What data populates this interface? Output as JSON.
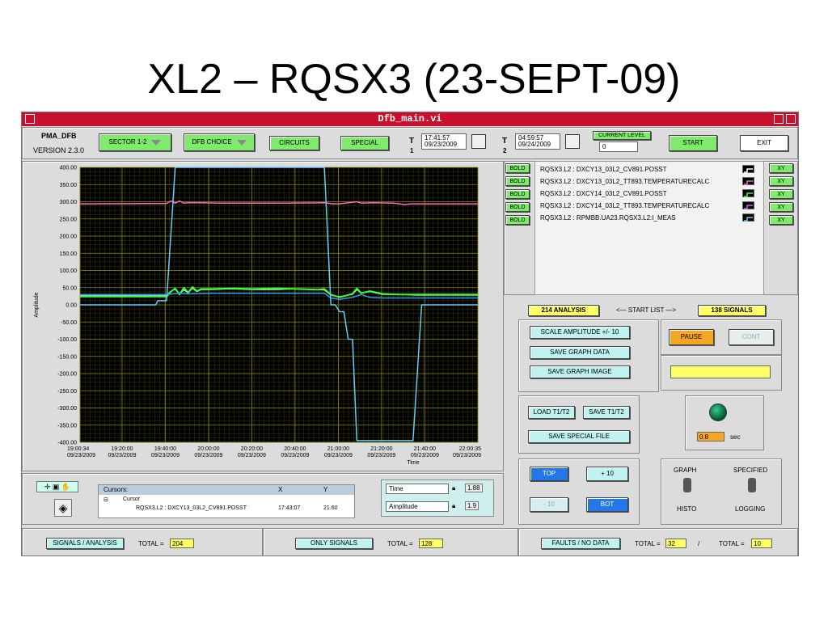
{
  "slide": {
    "title": "XL2 – RQSX3 (23-SEPT-09)"
  },
  "window": {
    "title": "Dfb_main.vi"
  },
  "header": {
    "app_name": "PMA_DFB",
    "version": "VERSION 2.3.0",
    "sector_label": "SECTOR 1-2",
    "dfb_choice_label": "DFB CHOICE",
    "circuits_label": "CIRCUITS",
    "special_label": "SPECIAL",
    "t1_label": "T",
    "t1_index": "1",
    "t1_time": "17:41:57",
    "t1_date": "09/23/2009",
    "t2_label": "T",
    "t2_index": "2",
    "t2_time": "04:59:57",
    "t2_date": "09/24/2009",
    "current_level_label": "CURRENT LEVEL",
    "current_level_value": "0",
    "start_label": "START",
    "exit_label": "EXIT"
  },
  "signals": {
    "bold_label": "BOLD",
    "xy_label": "XY",
    "items": [
      {
        "name": "RQSX3.L2 : DXCY13_03L2_CV891.POSST",
        "color": "#ffffff"
      },
      {
        "name": "RQSX3.L2 : DXCY13_03L2_TT893.TEMPERATURECALC",
        "color": "#ff66cc"
      },
      {
        "name": "RQSX3.L2 : DXCY14_03L2_CV891.POSST",
        "color": "#33ff33"
      },
      {
        "name": "RQSX3.L2 : DXCY14_03L2_TT893.TEMPERATURECALC",
        "color": "#cc66ff"
      },
      {
        "name": "RQSX3.L2 : RPMBB.UA23.RQSX3.L2:I_MEAS",
        "color": "#66ccff"
      }
    ]
  },
  "lists": {
    "analysis": "214 ANALYSIS",
    "start_list": "<— START LIST —>",
    "signals": "138 SIGNALS"
  },
  "controls": {
    "scale_amplitude": "SCALE AMPLITUDE +/- 10",
    "save_graph_data": "SAVE GRAPH DATA",
    "save_graph_image": "SAVE GRAPH IMAGE",
    "pause": "PAUSE",
    "cont": "CONT",
    "load_t1t2": "LOAD T1/T2",
    "save_t1t2": "SAVE T1/T2",
    "save_special_file": "SAVE SPECIAL FILE",
    "delay_value": "0.8",
    "delay_unit": "sec",
    "top": "TOP",
    "plus10": "+ 10",
    "minus10": "- 10",
    "bot": "BOT",
    "graph": "GRAPH",
    "histo": "HISTO",
    "specified": "SPECIFIED",
    "logging": "LOGGING"
  },
  "cursors": {
    "title": "Cursors:",
    "col_x": "X",
    "col_y": "Y",
    "cursor_label": "Cursor",
    "signal": "RQSX3.L2 : DXCY13_03L2_CV891.POSST",
    "x_value": "17:43:07",
    "y_value": "21.60"
  },
  "scales": {
    "time": "Time",
    "amplitude": "Amplitude",
    "fmt_x": "1.88",
    "fmt_y": "1.9"
  },
  "footer": {
    "signals_analysis": "SIGNALS / ANALYSIS",
    "total_label": "TOTAL =",
    "total_1": "204",
    "only_signals": "ONLY SIGNALS",
    "total_2": "128",
    "faults": "FAULTS / NO DATA",
    "total_3": "32",
    "sep": "/",
    "total_4": "10"
  },
  "chart_data": {
    "type": "line",
    "xlabel": "Time",
    "ylabel": "Amplitude",
    "ylim": [
      -400,
      400
    ],
    "yticks": [
      400,
      350,
      300,
      250,
      200,
      150,
      100,
      50,
      0,
      -50,
      -100,
      -150,
      -200,
      -250,
      -300,
      -350,
      -400
    ],
    "ytick_labels": [
      "400.00",
      "350.00",
      "300.00",
      "250.00",
      "200.00",
      "150.00",
      "100.00",
      "50.00",
      "0.00",
      "-50.00",
      "-100.00",
      "-150.00",
      "-200.00",
      "-250.00",
      "-300.00",
      "-350.00",
      "-400.00"
    ],
    "xlim": [
      0,
      123.97
    ],
    "xticks": [
      0,
      19.43,
      39.43,
      59.43,
      79.43,
      99.43,
      119.43,
      139.43,
      159.43,
      183.97
    ],
    "xtick_labels": [
      [
        "19:00:34",
        "09/23/2009"
      ],
      [
        "19:20:00",
        "09/23/2009"
      ],
      [
        "19:40:00",
        "09/23/2009"
      ],
      [
        "20:00:00",
        "09/23/2009"
      ],
      [
        "20:20:00",
        "09/23/2009"
      ],
      [
        "20:40:00",
        "09/23/2009"
      ],
      [
        "21:00:00",
        "09/23/2009"
      ],
      [
        "21:20:00",
        "09/23/2009"
      ],
      [
        "21:40:00",
        "09/23/2009"
      ],
      [
        "22:00:35",
        "09/23/2009"
      ]
    ],
    "x_domain": [
      0,
      183.97
    ],
    "grid": true,
    "series": [
      {
        "color": "#ff66cc",
        "width": 1.5,
        "points": [
          [
            0,
            294
          ],
          [
            40,
            295
          ],
          [
            42,
            302
          ],
          [
            44,
            296
          ],
          [
            46,
            302
          ],
          [
            48,
            296
          ],
          [
            50,
            297
          ],
          [
            55,
            297
          ],
          [
            65,
            296
          ],
          [
            80,
            296
          ],
          [
            95,
            296
          ],
          [
            113,
            297
          ],
          [
            117,
            294
          ],
          [
            120,
            294
          ],
          [
            128,
            300
          ],
          [
            130,
            296
          ],
          [
            135,
            297
          ],
          [
            145,
            296
          ],
          [
            150,
            292
          ],
          [
            153,
            294
          ],
          [
            158,
            294
          ],
          [
            170,
            294
          ],
          [
            183.97,
            294
          ]
        ]
      },
      {
        "color": "#ffffff",
        "width": 1,
        "points": [
          [
            0,
            28
          ],
          [
            40,
            28
          ],
          [
            42,
            40
          ],
          [
            44,
            45
          ],
          [
            46,
            30
          ],
          [
            48,
            44
          ],
          [
            50,
            34
          ],
          [
            52,
            48
          ],
          [
            54,
            38
          ],
          [
            56,
            44
          ],
          [
            60,
            44
          ],
          [
            70,
            46
          ],
          [
            80,
            44
          ],
          [
            90,
            44
          ],
          [
            100,
            46
          ],
          [
            110,
            44
          ],
          [
            113,
            43
          ],
          [
            116,
            28
          ],
          [
            120,
            24
          ],
          [
            126,
            30
          ],
          [
            128,
            44
          ],
          [
            130,
            34
          ],
          [
            134,
            38
          ],
          [
            140,
            30
          ],
          [
            148,
            30
          ],
          [
            155,
            28
          ],
          [
            170,
            28
          ],
          [
            183.97,
            28
          ]
        ]
      },
      {
        "color": "#33ff33",
        "width": 2,
        "points": [
          [
            0,
            24
          ],
          [
            40,
            24
          ],
          [
            42,
            38
          ],
          [
            44,
            48
          ],
          [
            46,
            30
          ],
          [
            48,
            50
          ],
          [
            50,
            36
          ],
          [
            52,
            52
          ],
          [
            54,
            40
          ],
          [
            56,
            46
          ],
          [
            60,
            46
          ],
          [
            70,
            48
          ],
          [
            80,
            46
          ],
          [
            90,
            48
          ],
          [
            100,
            46
          ],
          [
            110,
            44
          ],
          [
            113,
            46
          ],
          [
            116,
            30
          ],
          [
            120,
            22
          ],
          [
            126,
            32
          ],
          [
            128,
            48
          ],
          [
            130,
            34
          ],
          [
            134,
            40
          ],
          [
            140,
            32
          ],
          [
            148,
            30
          ],
          [
            155,
            30
          ],
          [
            170,
            30
          ],
          [
            183.97,
            30
          ]
        ]
      },
      {
        "color": "#3399ff",
        "width": 1.5,
        "points": [
          [
            0,
            30
          ],
          [
            40,
            30
          ],
          [
            43,
            32
          ],
          [
            46,
            34
          ],
          [
            50,
            32
          ],
          [
            60,
            34
          ],
          [
            80,
            34
          ],
          [
            100,
            34
          ],
          [
            113,
            34
          ],
          [
            116,
            20
          ],
          [
            120,
            16
          ],
          [
            126,
            22
          ],
          [
            130,
            30
          ],
          [
            134,
            22
          ],
          [
            140,
            20
          ],
          [
            150,
            20
          ],
          [
            160,
            20
          ],
          [
            170,
            20
          ],
          [
            183.97,
            20
          ]
        ]
      },
      {
        "color": "#66ccff",
        "width": 1.5,
        "points": [
          [
            0,
            0
          ],
          [
            35,
            0
          ],
          [
            36,
            12
          ],
          [
            40,
            12
          ],
          [
            44,
            400
          ],
          [
            60,
            400
          ],
          [
            80,
            400
          ],
          [
            94,
            400
          ],
          [
            96,
            400
          ],
          [
            98,
            400
          ],
          [
            102,
            400
          ],
          [
            106,
            400
          ],
          [
            111,
            400
          ],
          [
            113,
            400
          ],
          [
            116,
            0
          ],
          [
            118,
            0
          ],
          [
            120,
            -20
          ],
          [
            122,
            -20
          ],
          [
            124,
            -100
          ],
          [
            126,
            -100
          ],
          [
            128,
            -395
          ],
          [
            145,
            -395
          ],
          [
            150,
            -395
          ],
          [
            152,
            -395
          ],
          [
            154,
            -395
          ],
          [
            158,
            0
          ],
          [
            170,
            0
          ],
          [
            183.97,
            0
          ]
        ]
      }
    ]
  }
}
